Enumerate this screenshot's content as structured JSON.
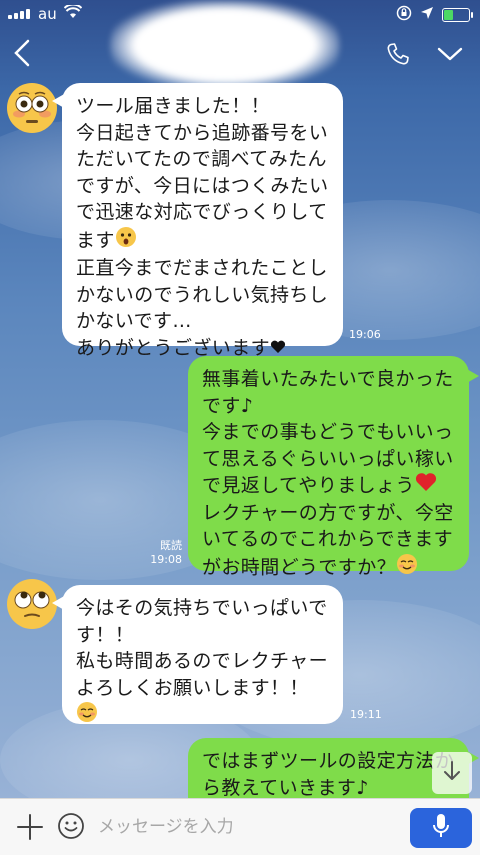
{
  "status_bar": {
    "carrier": "au"
  },
  "header": {
    "contact_name": ""
  },
  "messages": [
    {
      "side": "incoming",
      "avatar": "flushed-face-icon",
      "text": "ツール届きました！！\n今日起きてから追跡番号をいただいてたので調べてみたんですが、今日にはつくみたいで迅速な対応でびっくりしてます",
      "text_after_emoji": "\n正直今までだまされたことしかないのでうれしい気持ちしかないです…\nありがとうございます",
      "time": "19:06"
    },
    {
      "side": "outgoing",
      "text": "無事着いたみたいで良かったです♪\n今までの事もどうでもいいって思えるぐらいいっぱい稼いで見返してやりましょう",
      "text_after_emoji": "\nレクチャーの方ですが、今空いてるのでこれからできますがお時間どうですか？",
      "read_label": "既読",
      "time": "19:08"
    },
    {
      "side": "incoming",
      "avatar": "eye-roll-face-icon",
      "text": "今はその気持ちでいっぱいです！！\n私も時間あるのでレクチャーよろしくお願いします！！",
      "time": "19:11"
    },
    {
      "side": "outgoing",
      "text": "ではまずツールの設定方法から教えていきます♪"
    }
  ],
  "input": {
    "placeholder": "メッセージを入力"
  },
  "colors": {
    "outgoing_bubble": "#7fdc4a",
    "incoming_bubble": "#ffffff",
    "send_button": "#2b64dc"
  }
}
